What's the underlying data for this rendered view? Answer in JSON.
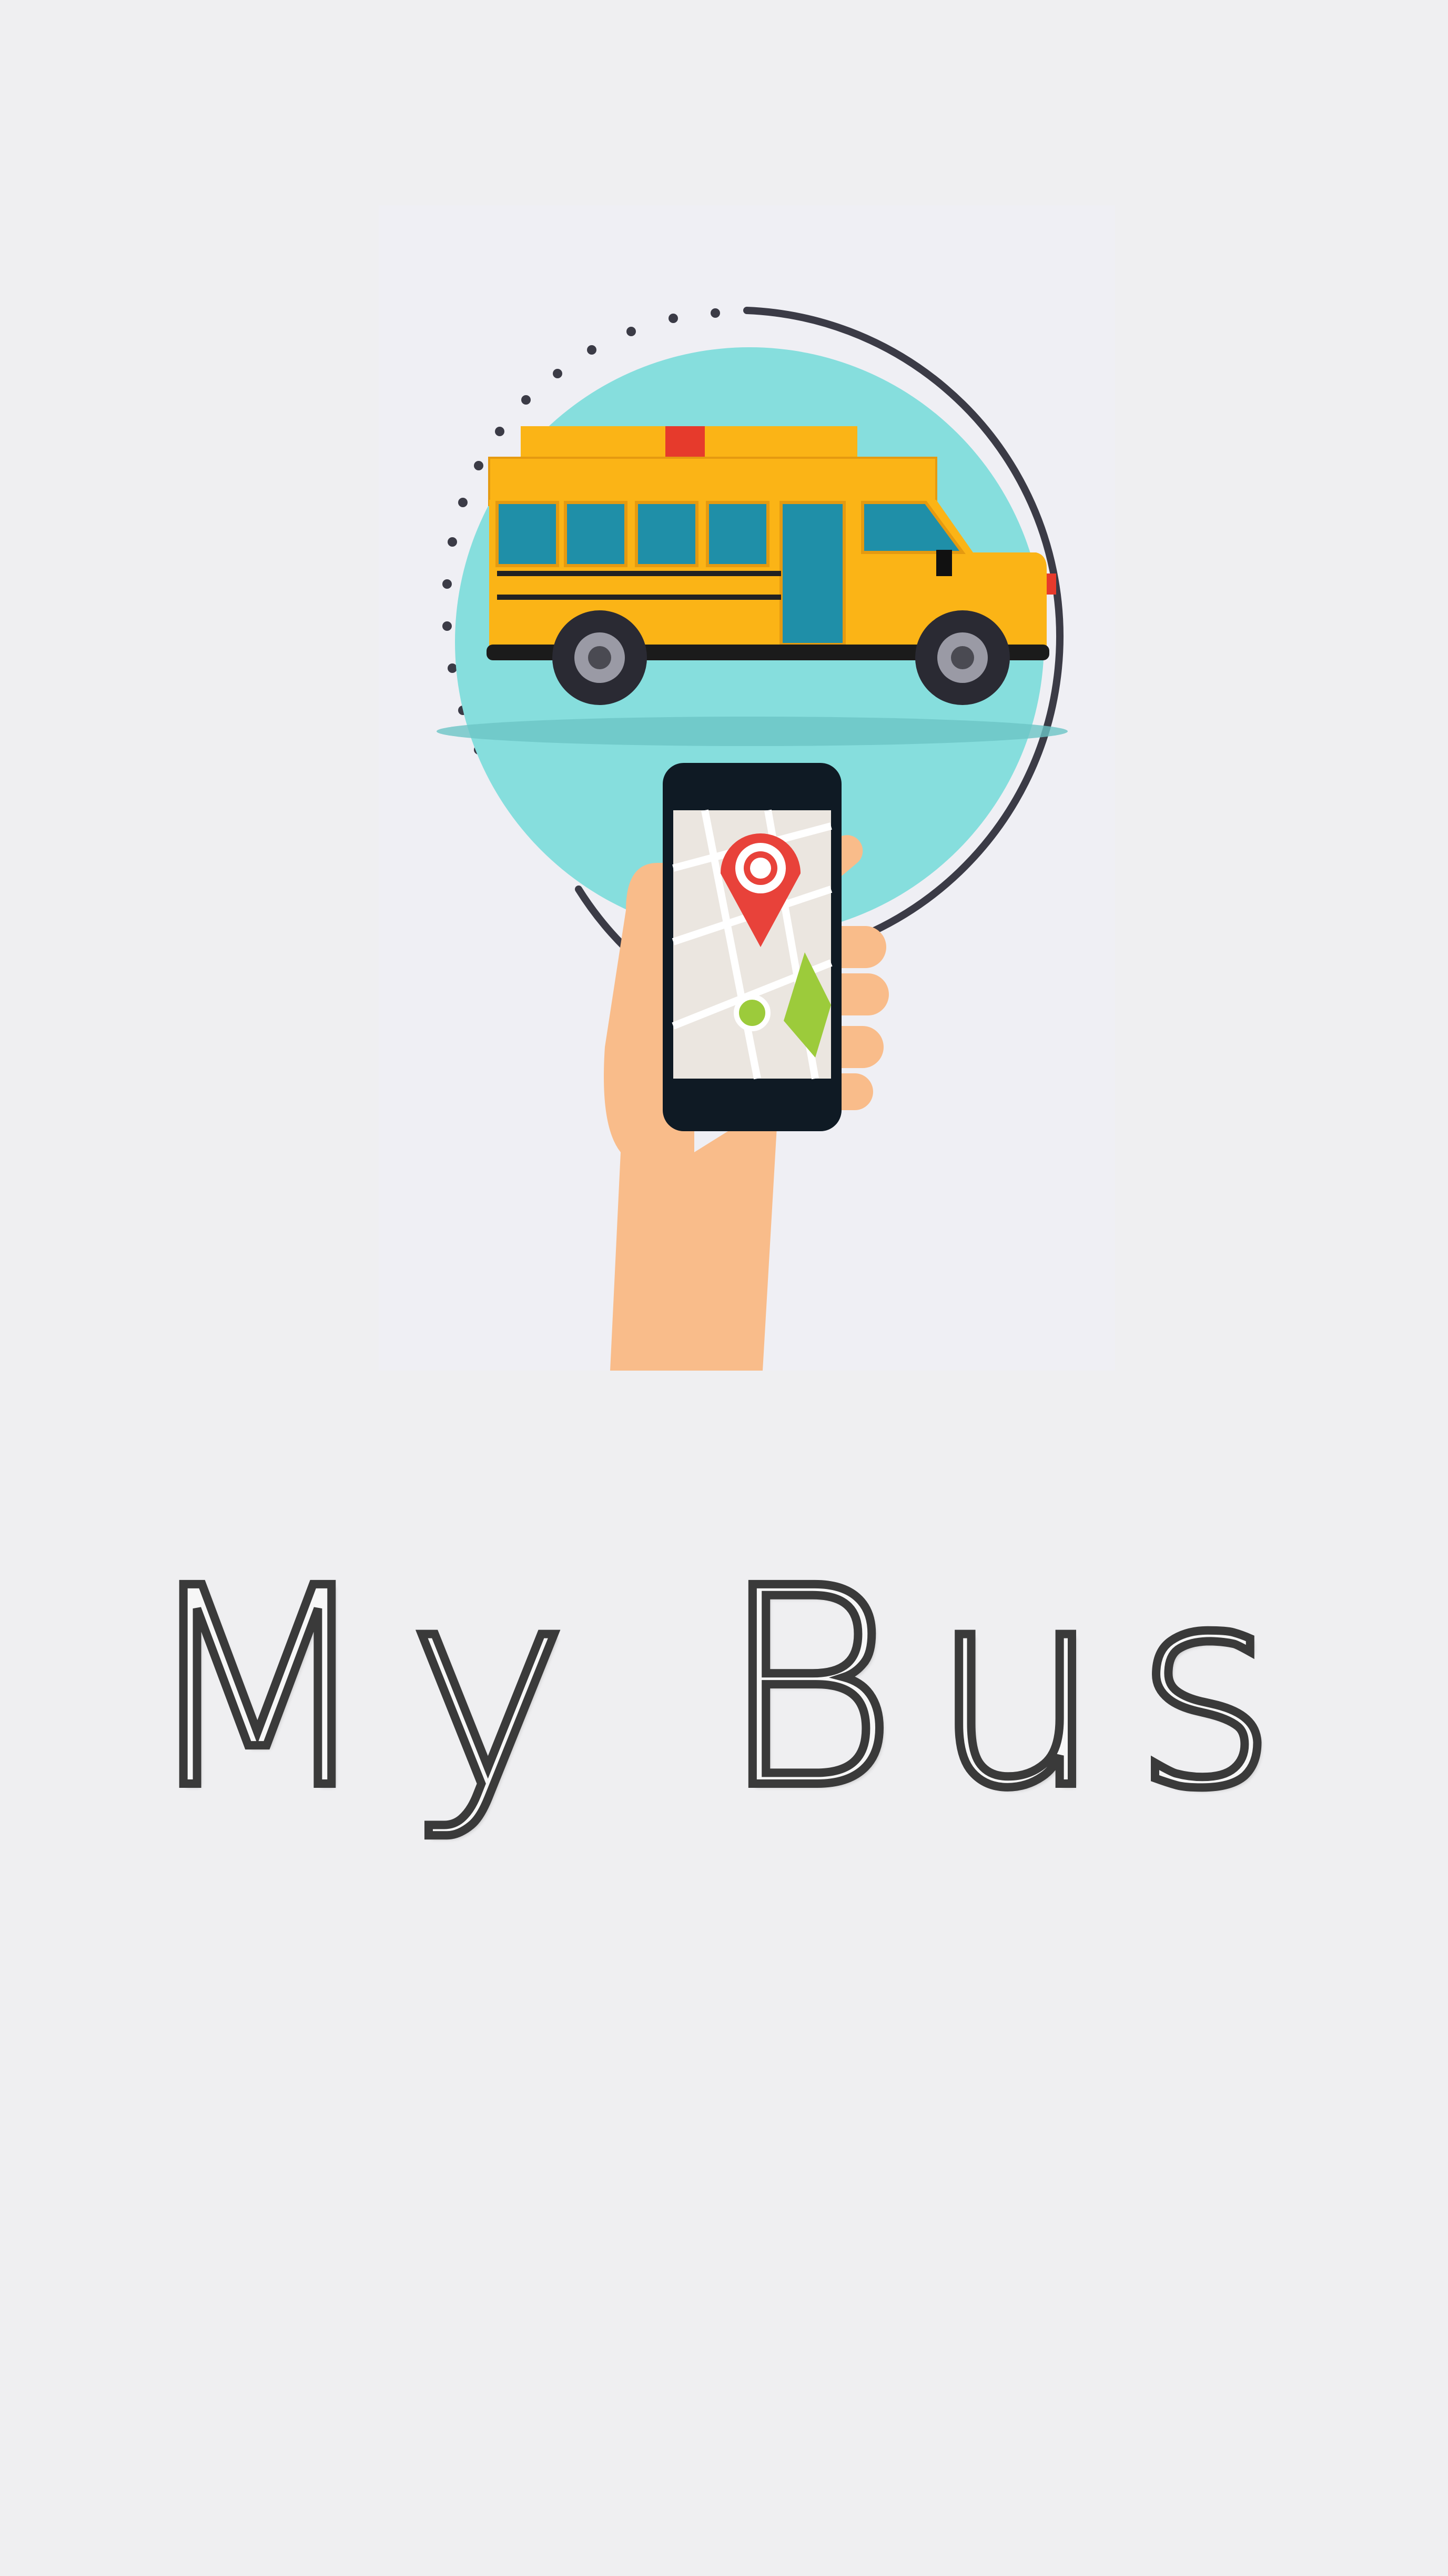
{
  "splash": {
    "title": "My Bus",
    "illustration_icon": "school-bus-tracking-icon"
  },
  "colors": {
    "background": "#efeff1",
    "circle": "#86dedd",
    "bus_body": "#fbb416",
    "bus_window": "#1f8fa8",
    "hand": "#f9bc8a",
    "phone": "#0f1a24",
    "pin": "#e8423a",
    "title_stroke": "#3a3a3a"
  }
}
